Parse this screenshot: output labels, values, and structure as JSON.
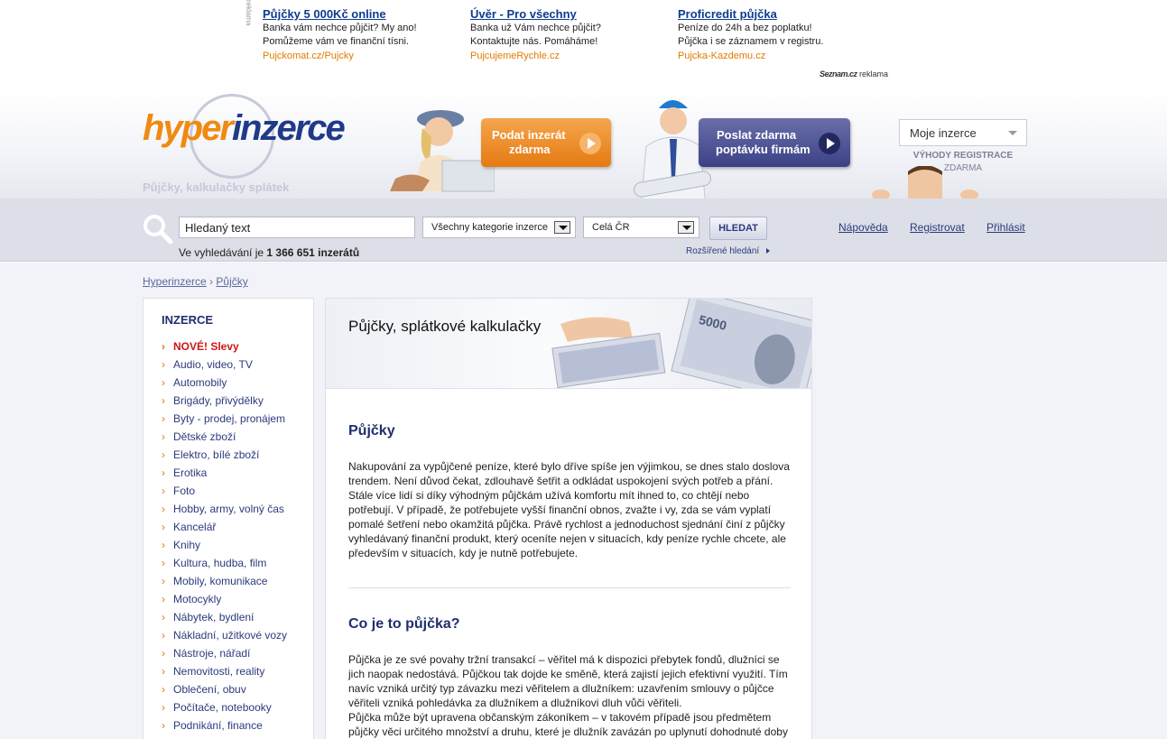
{
  "ads": {
    "label": "reklama",
    "items": [
      {
        "title": "Půjčky 5 000Kč online",
        "lines": [
          "Banka vám nechce půjčit? My ano!",
          "Pomůžeme vám ve finanční tísni."
        ],
        "url": "Pujckomat.cz/Pujcky"
      },
      {
        "title": "Úvěr - Pro všechny",
        "lines": [
          "Banka už Vám nechce půjčit?",
          "Kontaktujte nás. Pomáháme!"
        ],
        "url": "PujcujemeRychle.cz"
      },
      {
        "title": "Proficredit půjčka",
        "lines": [
          "Peníze do 24h a bez poplatku!",
          "Půjčka i se záznamem v registru."
        ],
        "url": "Pujcka-Kazdemu.cz"
      }
    ],
    "sponsor_logo": "Seznam.cz",
    "sponsor_label": "reklama"
  },
  "header": {
    "logo_part1": "hyper",
    "logo_part2": "inzerce",
    "tagline": "Půjčky, kalkulačky splátek",
    "cta_orange_line1": "Podat inzerát",
    "cta_orange_line2": "zdarma",
    "cta_blue_line1": "Poslat zdarma",
    "cta_blue_line2": "poptávku firmám",
    "account_select": "Moje inzerce",
    "benefits_line1": "VÝHODY REGISTRACE",
    "benefits_line2": "ZDARMA"
  },
  "search": {
    "query": "Hledaný text",
    "category": "Všechny kategorie inzerce",
    "region": "Celá ČR",
    "button": "HLEDAT",
    "count_prefix": "Ve vyhledávání je",
    "count_value": "1 366 651 inzerátů",
    "advanced": "Rozšířené hledání"
  },
  "toplinks": {
    "help": "Nápověda",
    "register": "Registrovat",
    "login": "Přihlásit"
  },
  "breadcrumb": {
    "home": "Hyperinzerce",
    "sep": "›",
    "current": "Půjčky"
  },
  "sidebar": {
    "title": "INZERCE",
    "items": [
      "NOVÉ! Slevy",
      "Audio, video, TV",
      "Automobily",
      "Brigády, přivýdělky",
      "Byty - prodej, pronájem",
      "Dětské zboží",
      "Elektro, bílé zboží",
      "Erotika",
      "Foto",
      "Hobby, army, volný čas",
      "Kancelář",
      "Knihy",
      "Kultura, hudba, film",
      "Mobily, komunikace",
      "Motocykly",
      "Nábytek, bydlení",
      "Nákladní, užitkové vozy",
      "Nástroje, nářadí",
      "Nemovitosti, reality",
      "Oblečení, obuv",
      "Počítače, notebooky",
      "Podnikání, finance"
    ]
  },
  "content": {
    "banner_title": "Půjčky, splátkové kalkulačky",
    "section1_title": "Půjčky",
    "section1_text": "Nakupování za vypůjčené peníze, které bylo dříve spíše jen výjimkou, se dnes stalo doslova trendem. Není důvod čekat, zdlouhavě šetřit a odkládat uspokojení svých potřeb a přání. Stále více lidí si díky výhodným půjčkám užívá komfortu mít ihned to, co chtějí nebo potřebují. V případě, že potřebujete vyšší finanční obnos, zvažte i vy, zda se vám vyplatí pomalé šetření nebo okamžitá půjčka. Právě rychlost a jednoduchost sjednání činí z půjčky vyhledávaný finanční produkt, který oceníte nejen v situacích, kdy peníze rychle chcete, ale především v situacích, kdy je nutně potřebujete.",
    "section2_title": "Co je to půjčka?",
    "section2_text1": "Půjčka je ze své povahy tržní transakcí – věřitel má k dispozici přebytek fondů, dlužníci se jich naopak nedostává. Půjčkou tak dojde ke směně, která zajistí jejich efektivní využití. Tím navíc vzniká určitý typ závazku mezi věřitelem a dlužníkem: uzavřením smlouvy o půjčce věřiteli vzniká pohledávka za dlužníkem a dlužníkovi dluh vůči věřiteli.",
    "section2_text2": "Půjčka může být upravena občanským zákoníkem – v takovém případě jsou předmětem půjčky věci určitého množství a druhu, které je dlužník zavázán po uplynutí dohodnuté doby",
    "banknote_text": "5000"
  }
}
